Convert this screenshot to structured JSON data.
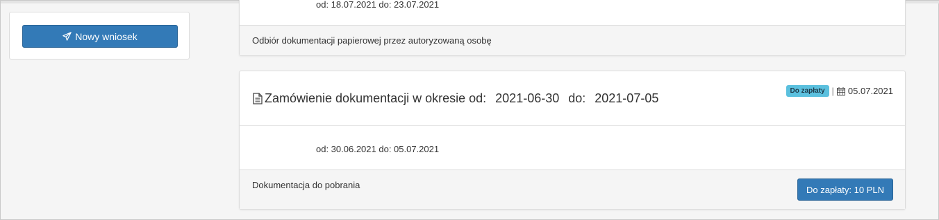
{
  "sidebar": {
    "new_request_label": "Nowy wniosek",
    "new_request_icon": "paper-plane-icon"
  },
  "requests": [
    {
      "dates_line": "od: 18.07.2021 do: 23.07.2021",
      "footer_text": "Odbiór dokumentacji papierowej przez autoryzowaną osobę"
    },
    {
      "title_prefix": "Zamówienie dokumentacji w okresie od:",
      "date_from": "2021-06-30",
      "title_middle": "do:",
      "date_to": "2021-07-05",
      "status_badge": "Do zapłaty",
      "separator": "|",
      "created_date": "05.07.2021",
      "dates_line": "od: 30.06.2021 do: 05.07.2021",
      "footer_text": "Dokumentacja do pobrania",
      "pay_button_label": "Do zapłaty: 10 PLN"
    }
  ],
  "colors": {
    "primary": "#337ab7",
    "badge_info": "#5bc0de",
    "background": "#f5f5f5"
  }
}
